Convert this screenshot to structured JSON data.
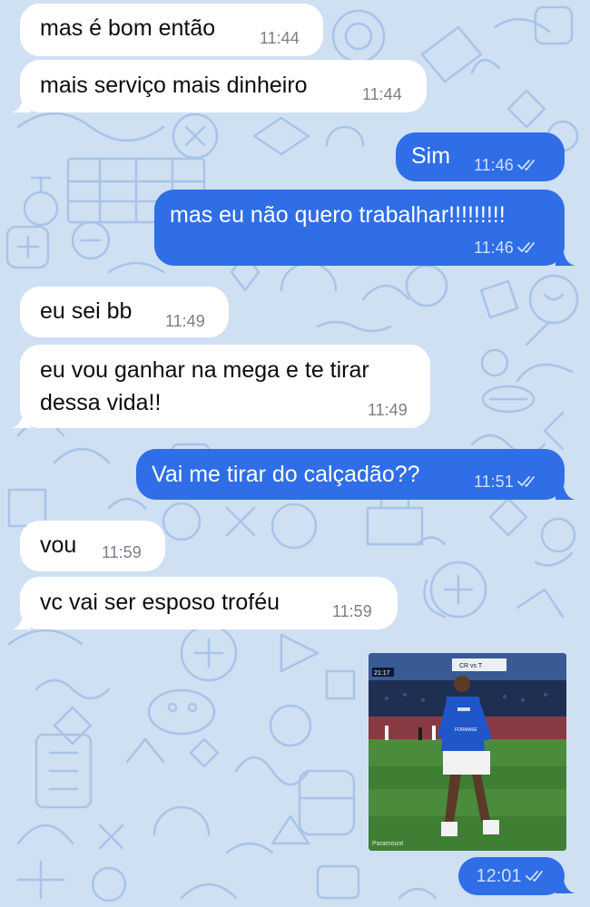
{
  "messages": [
    {
      "id": "m1",
      "direction": "incoming",
      "text": "mas é bom então",
      "time": "11:44"
    },
    {
      "id": "m2",
      "direction": "incoming",
      "text": "mais serviço mais dinheiro",
      "time": "11:44"
    },
    {
      "id": "m3",
      "direction": "outgoing",
      "text": "Sim",
      "time": "11:46",
      "status": "read"
    },
    {
      "id": "m4",
      "direction": "outgoing",
      "text": "mas eu não quero trabalhar!!!!!!!!!",
      "time": "11:46",
      "status": "read"
    },
    {
      "id": "m5",
      "direction": "incoming",
      "text": "eu sei bb",
      "time": "11:49"
    },
    {
      "id": "m6",
      "direction": "incoming",
      "text_line1": "eu vou ganhar na mega e te tirar",
      "text_line2": "dessa vida!!",
      "time": "11:49"
    },
    {
      "id": "m7",
      "direction": "outgoing",
      "text": "Vai me tirar do calçadão??",
      "time": "11:51",
      "status": "read"
    },
    {
      "id": "m8",
      "direction": "incoming",
      "text": "vou",
      "time": "11:59"
    },
    {
      "id": "m9",
      "direction": "incoming",
      "text": "vc vai ser esposo troféu",
      "time": "11:59"
    },
    {
      "id": "m10",
      "direction": "outgoing",
      "type": "video-gif",
      "time": "12:01",
      "status": "read",
      "media": {
        "broadcast_clock": "21:17",
        "scoreboard": "CR vs T",
        "jersey_sponsor": "FORMASE",
        "broadcaster_watermark": "Paramount",
        "scene": "soccer-player-celebrating-on-pitch"
      }
    }
  ],
  "colors": {
    "chat_background": "#cfe0f3",
    "wallpaper_doodle": "#a9c3e8",
    "incoming_bubble": "#ffffff",
    "outgoing_bubble": "#2f6ee6",
    "incoming_text": "#0d0d0d",
    "outgoing_text": "#ffffff",
    "incoming_meta": "#7a7f87",
    "outgoing_meta": "#cfe0ff"
  },
  "icons": {
    "read_receipt": "double-check-icon"
  }
}
